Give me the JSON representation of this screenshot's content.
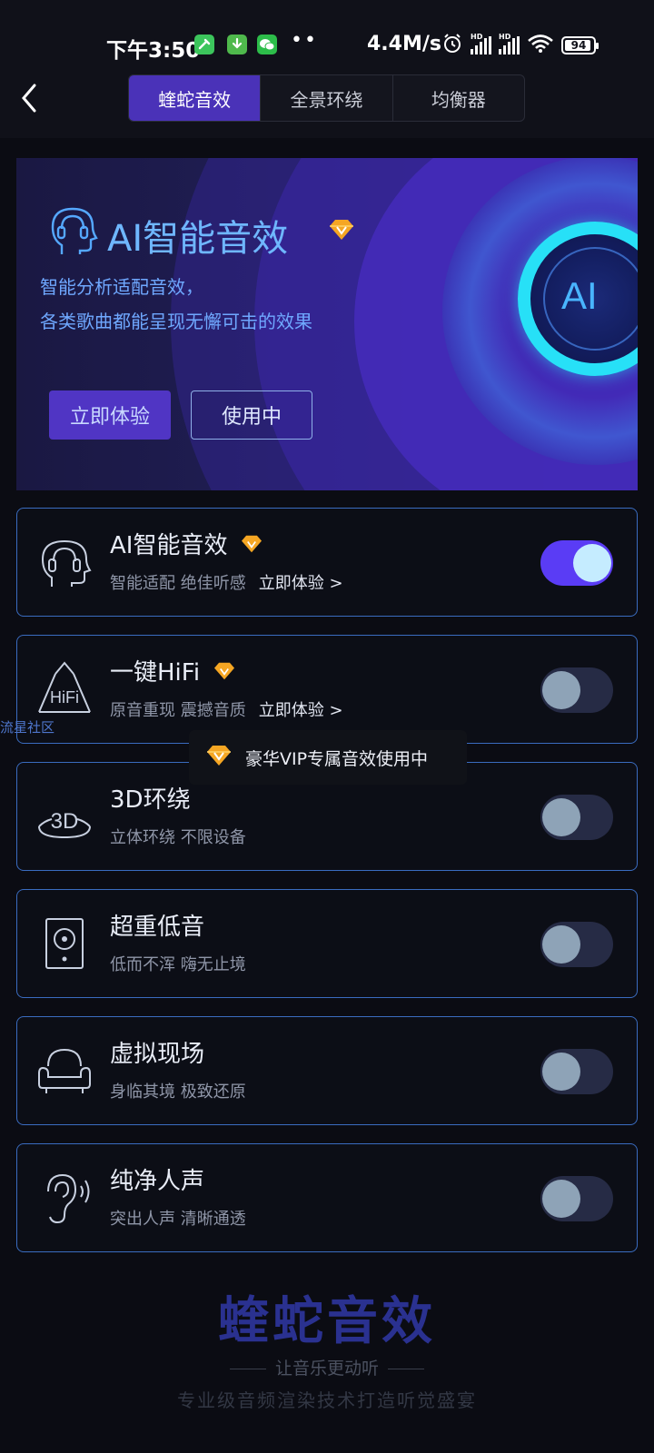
{
  "status_bar": {
    "time": "下午3:50",
    "dots": "••",
    "net_speed": "4.4M/s",
    "hd_label": "HD",
    "battery": "94"
  },
  "nav": {
    "tabs": [
      {
        "label": "蝰蛇音效",
        "active": true
      },
      {
        "label": "全景环绕",
        "active": false
      },
      {
        "label": "均衡器",
        "active": false
      }
    ]
  },
  "banner": {
    "title": "AI智能音效",
    "desc_line1": "智能分析适配音效，",
    "desc_line2": "各类歌曲都能呈现无懈可击的效果",
    "try_button": "立即体验",
    "using_button": "使用中",
    "disc_label": "AI"
  },
  "effects": [
    {
      "name": "AI智能音效",
      "vip": true,
      "desc": "智能适配 绝佳听感",
      "try": "立即体验 >",
      "enabled": true,
      "icon": "ai-head-icon"
    },
    {
      "name": "一键HiFi",
      "vip": true,
      "desc": "原音重现 震撼音质",
      "try": "立即体验 >",
      "enabled": false,
      "icon": "hifi-icon",
      "icon_text": "HiFi"
    },
    {
      "name": "3D环绕",
      "vip": false,
      "desc": "立体环绕 不限设备",
      "try": "",
      "enabled": false,
      "icon": "3d-surround-icon",
      "icon_text": "3D"
    },
    {
      "name": "超重低音",
      "vip": false,
      "desc": "低而不浑 嗨无止境",
      "try": "",
      "enabled": false,
      "icon": "speaker-icon"
    },
    {
      "name": "虚拟现场",
      "vip": false,
      "desc": "身临其境 极致还原",
      "try": "",
      "enabled": false,
      "icon": "sofa-icon"
    },
    {
      "name": "纯净人声",
      "vip": false,
      "desc": "突出人声 清晰通透",
      "try": "",
      "enabled": false,
      "icon": "ear-icon"
    }
  ],
  "watermark": "流星社区",
  "toast": "豪华VIP专属音效使用中",
  "footer": {
    "title": "蝰蛇音效",
    "tagline": "让音乐更动听",
    "subtitle": "专业级音频渲染技术打造听觉盛宴"
  },
  "colors": {
    "accent": "#4a32b8",
    "toggle_on": "#5a3cf5",
    "card_border": "#3a6cc0",
    "vip_gold": "#f5a623"
  }
}
